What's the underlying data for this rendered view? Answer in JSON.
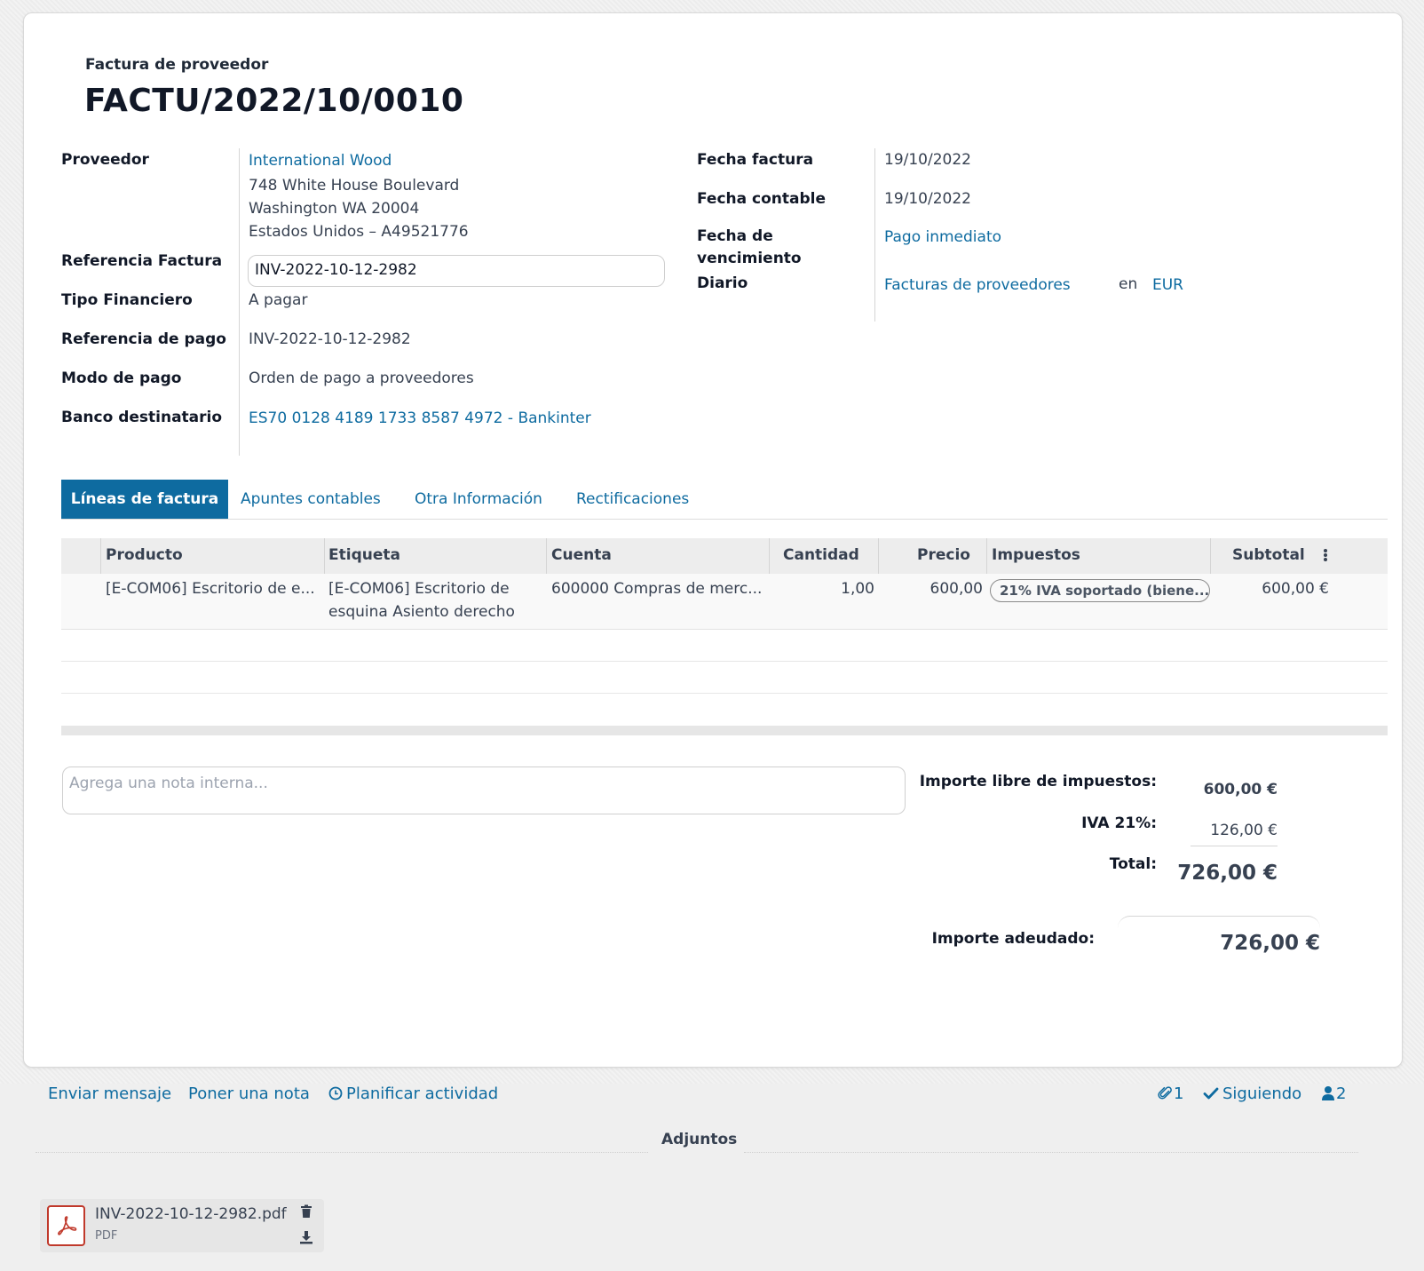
{
  "header": {
    "doc_type": "Factura de proveedor",
    "doc_name": "FACTU/2022/10/0010"
  },
  "left_fields": {
    "supplier_label": "Proveedor",
    "supplier_name": "International Wood",
    "supplier_addr1": "748 White House Boulevard",
    "supplier_addr2": "Washington WA 20004",
    "supplier_addr3": "Estados Unidos – A49521776",
    "invoice_ref_label": "Referencia Factura",
    "invoice_ref_value": "INV-2022-10-12-2982",
    "fin_type_label": "Tipo Financiero",
    "fin_type_value": "A pagar",
    "payment_ref_label": "Referencia de pago",
    "payment_ref_value": "INV-2022-10-12-2982",
    "payment_mode_label": "Modo de pago",
    "payment_mode_value": "Orden de pago a proveedores",
    "bank_label": "Banco destinatario",
    "bank_value": "ES70 0128 4189 1733 8587 4972 - Bankinter"
  },
  "right_fields": {
    "invoice_date_label": "Fecha factura",
    "invoice_date_value": "19/10/2022",
    "accounting_date_label": "Fecha contable",
    "accounting_date_value": "19/10/2022",
    "due_date_label_1": "Fecha de",
    "due_date_label_2": "vencimiento",
    "due_date_value": "Pago inmediato",
    "journal_label": "Diario",
    "journal_value": "Facturas de proveedores",
    "journal_in": "en",
    "currency": "EUR"
  },
  "tabs": [
    {
      "label": "Líneas de factura",
      "active": true
    },
    {
      "label": "Apuntes contables",
      "active": false
    },
    {
      "label": "Otra Información",
      "active": false
    },
    {
      "label": "Rectificaciones",
      "active": false
    }
  ],
  "table": {
    "headers": [
      "Producto",
      "Etiqueta",
      "Cuenta",
      "Cantidad",
      "Precio",
      "Impuestos",
      "Subtotal"
    ],
    "rows": [
      {
        "product": "[E-COM06] Escritorio de e...",
        "label_line1": "[E-COM06] Escritorio de",
        "label_line2": "esquina Asiento derecho",
        "account": "600000 Compras de merc...",
        "quantity": "1,00",
        "price": "600,00",
        "tax": "21% IVA soportado (biene...",
        "subtotal": "600,00 €"
      }
    ]
  },
  "note": {
    "placeholder": "Agrega una nota interna..."
  },
  "totals": {
    "untaxed_label": "Importe libre de impuestos:",
    "untaxed_value": "600,00 €",
    "vat_label": "IVA 21%:",
    "vat_value": "126,00 €",
    "total_label": "Total:",
    "total_value": "726,00 €",
    "due_label": "Importe adeudado:",
    "due_value": "726,00 €"
  },
  "chatter": {
    "send_message": "Enviar mensaje",
    "log_note": "Poner una nota",
    "schedule_activity": "Planificar actividad",
    "attachments_count": "1",
    "following": "Siguiendo",
    "followers_count": "2",
    "attachments_title": "Adjuntos"
  },
  "attachment": {
    "filename": "INV-2022-10-12-2982.pdf",
    "type": "PDF"
  },
  "colors": {
    "accent": "#0e6ba0",
    "pdf_red": "#c0392b"
  }
}
